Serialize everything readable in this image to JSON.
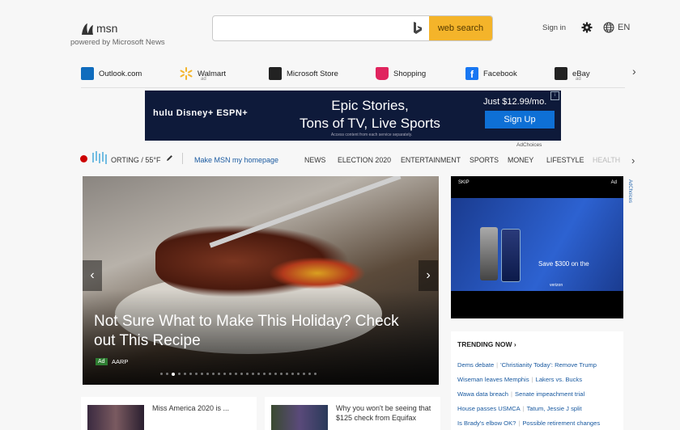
{
  "header": {
    "logo_text": "msn",
    "powered_by": "powered by Microsoft News",
    "search": {
      "value": "",
      "placeholder": "",
      "button_label": "web search"
    },
    "sign_in": "Sign in",
    "language": "EN"
  },
  "quick_links": [
    {
      "label": "Outlook.com",
      "sub": "",
      "icon": "outlook-icon",
      "color": "#0f6cbd"
    },
    {
      "label": "Walmart",
      "sub": "ad",
      "icon": "walmart-icon",
      "color": "#f4b42a"
    },
    {
      "label": "Microsoft Store",
      "sub": "",
      "icon": "microsoft-store-icon",
      "color": "#222222"
    },
    {
      "label": "Shopping",
      "sub": "",
      "icon": "shopping-icon",
      "color": "#e0245e"
    },
    {
      "label": "Facebook",
      "sub": "",
      "icon": "facebook-icon",
      "color": "#1877f2"
    },
    {
      "label": "eBay",
      "sub": "ad",
      "icon": "ebay-icon",
      "color": "#222222"
    }
  ],
  "banner_ad": {
    "brands": "hulu  Disney+  ESPN+",
    "headline_line1": "Epic Stories,",
    "headline_line2": "Tons of TV, Live Sports",
    "fine_print": "Access content from each service separately.",
    "price": "Just $12.99/mo.",
    "cta": "Sign Up",
    "adchoices": "AdChoices"
  },
  "nav": {
    "weather": "ORTING / 55°F",
    "homepage": "Make MSN my homepage",
    "items": [
      "NEWS",
      "ELECTION 2020",
      "ENTERTAINMENT",
      "SPORTS",
      "MONEY",
      "LIFESTYLE",
      "HEALTH"
    ]
  },
  "hero": {
    "title": "Not Sure What to Make This Holiday? Check out This Recipe",
    "ad_tag": "Ad",
    "source": "AARP",
    "slide_count": 28,
    "active_slide": 3
  },
  "cards": [
    {
      "text": "Miss America 2020 is ..."
    },
    {
      "text": "Why you won't be seeing that $125 check from Equifax"
    }
  ],
  "video_ad": {
    "skip": "SKIP",
    "ad_label": "Ad",
    "offer": "Save $300 on the",
    "brand": "verizon",
    "adchoices": "AdChoices"
  },
  "trending": {
    "title": "TRENDING NOW",
    "rows": [
      [
        "Dems debate",
        "'Christianity Today': Remove Trump"
      ],
      [
        "Wiseman leaves Memphis",
        "Lakers vs. Bucks"
      ],
      [
        "Wawa data breach",
        "Senate impeachment trial"
      ],
      [
        "House passes USMCA",
        "Tatum, Jessie J split"
      ],
      [
        "Is Brady's elbow OK?",
        "Possible retirement changes"
      ]
    ]
  }
}
